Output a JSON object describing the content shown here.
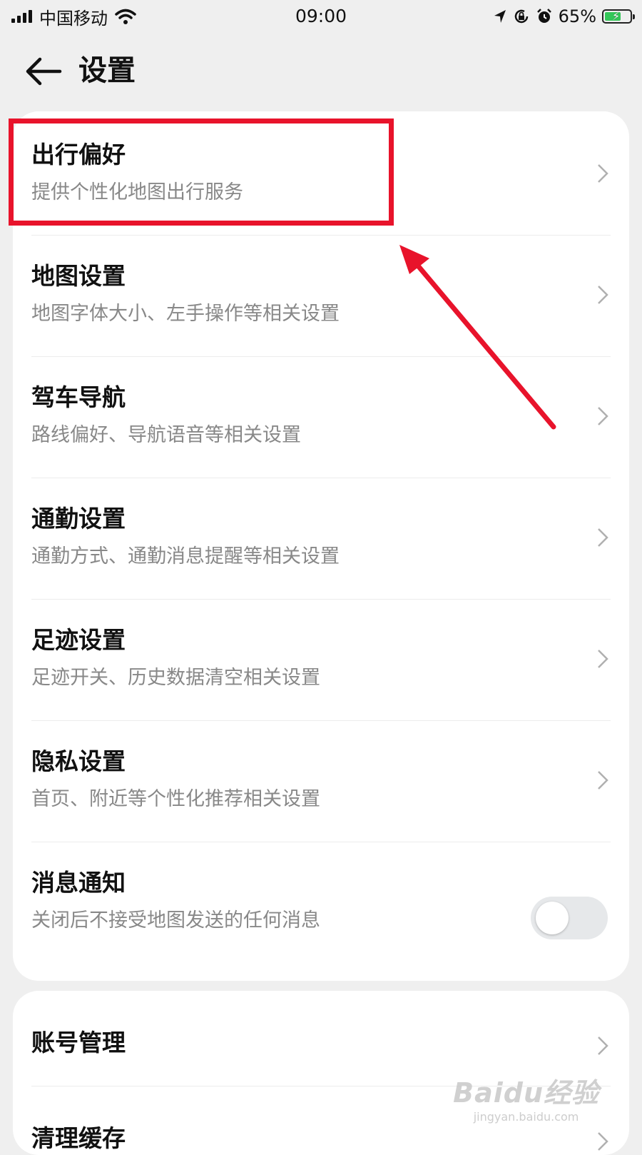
{
  "status_bar": {
    "carrier": "中国移动",
    "time": "09:00",
    "battery": "65%",
    "battery_level": 0.65,
    "icons": [
      "signal-icon",
      "wifi-icon",
      "location-icon",
      "rotation-lock-icon",
      "alarm-icon",
      "battery-icon"
    ]
  },
  "header": {
    "title": "设置",
    "back_icon": "arrow-left-icon"
  },
  "settings": [
    {
      "title": "出行偏好",
      "subtitle": "提供个性化地图出行服务"
    },
    {
      "title": "地图设置",
      "subtitle": "地图字体大小、左手操作等相关设置"
    },
    {
      "title": "驾车导航",
      "subtitle": "路线偏好、导航语音等相关设置"
    },
    {
      "title": "通勤设置",
      "subtitle": "通勤方式、通勤消息提醒等相关设置"
    },
    {
      "title": "足迹设置",
      "subtitle": "足迹开关、历史数据清空相关设置"
    },
    {
      "title": "隐私设置",
      "subtitle": "首页、附近等个性化推荐相关设置"
    },
    {
      "title": "消息通知",
      "subtitle": "关闭后不接受地图发送的任何消息",
      "toggle": false
    }
  ],
  "account": [
    {
      "title": "账号管理"
    },
    {
      "title": "清理缓存"
    }
  ],
  "annotation": {
    "color": "#e8132b"
  },
  "watermark": {
    "main": "Baidu经验",
    "sub": "jingyan.baidu.com"
  }
}
